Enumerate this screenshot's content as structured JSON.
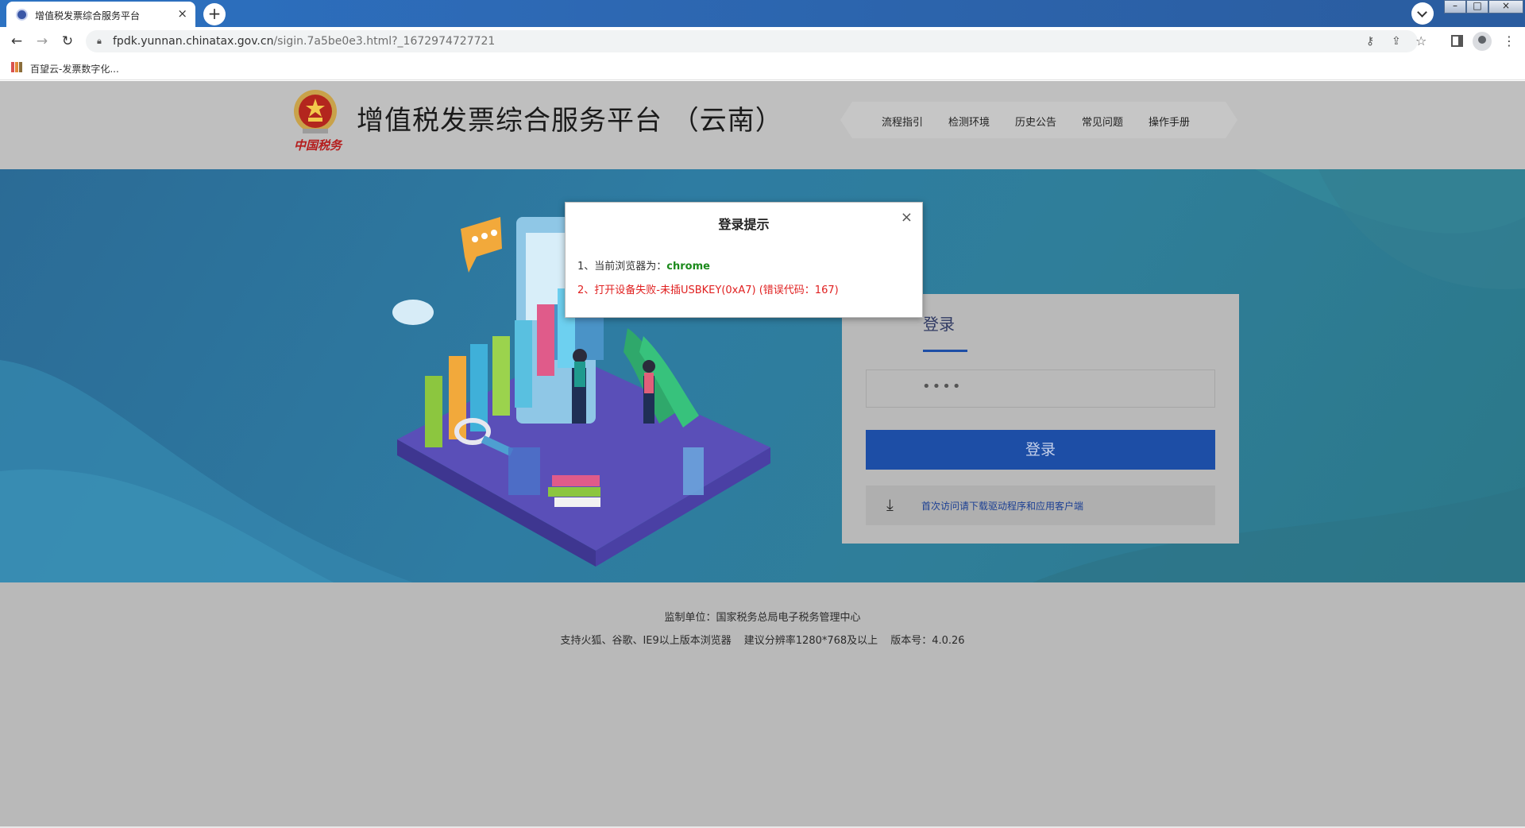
{
  "browser": {
    "tab_title": "增值税发票综合服务平台",
    "tab_close": "×",
    "new_tab": "+",
    "url_host": "fpdk.yunnan.chinatax.gov.cn",
    "url_path": "/sigin.7a5be0e3.html?_1672974727721",
    "bookmark_label": "百望云-发票数字化...",
    "window_buttons": {
      "minimize": "–",
      "maximize": "□",
      "close": "×"
    }
  },
  "header": {
    "emblem_caption": "中国税务",
    "title": "增值税发票综合服务平台 （云南）",
    "nav": [
      "流程指引",
      "检测环境",
      "历史公告",
      "常见问题",
      "操作手册"
    ]
  },
  "login": {
    "tab_label": "登录",
    "password_mask": "••••",
    "button_label": "登录",
    "download_text": "首次访问请下载驱动程序和应用客户端"
  },
  "footer": {
    "line1": "监制单位：国家税务总局电子税务管理中心",
    "line2_parts": [
      "支持火狐、谷歌、IE9以上版本浏览器",
      "建议分辨率1280*768及以上",
      "版本号：4.0.26"
    ]
  },
  "modal": {
    "title": "登录提示",
    "close": "×",
    "line1_prefix": "1、当前浏览器为：",
    "line1_value": "chrome",
    "line2": "2、打开设备失败-未插USBKEY(0xA7) (错误代码：167)"
  },
  "colors": {
    "accent_blue": "#1d4ea6",
    "success_green": "#1c8a1c",
    "error_red": "#e02020",
    "overlay_gray": "#b9b9b9"
  },
  "icons": [
    "back-arrow-icon",
    "forward-arrow-icon",
    "reload-icon",
    "lock-icon",
    "key-icon",
    "share-icon",
    "star-icon",
    "side-panel-icon",
    "profile-icon",
    "kebab-menu-icon",
    "download-icon",
    "close-icon"
  ]
}
